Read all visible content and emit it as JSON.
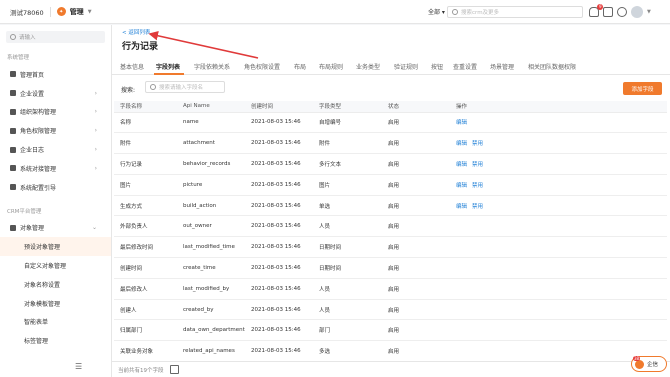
{
  "topbar": {
    "company": "测试78060",
    "module": "管理",
    "scope": "全部 ▾",
    "search_placeholder": "搜索crm及更多",
    "notification_count": "9"
  },
  "sidebar": {
    "search_placeholder": "请输入",
    "group_system": "系统管理",
    "items": [
      {
        "label": "管理首页"
      },
      {
        "label": "企业设置"
      },
      {
        "label": "组织架构管理"
      },
      {
        "label": "角色权限管理"
      },
      {
        "label": "企业日志"
      },
      {
        "label": "系统对接管理"
      },
      {
        "label": "系统配置引导"
      }
    ],
    "group_crm": "CRM平台管理",
    "object_mgmt": "对象管理",
    "sub_items": [
      {
        "label": "预设对象管理"
      },
      {
        "label": "自定义对象管理"
      },
      {
        "label": "对象名称设置"
      },
      {
        "label": "对象模板管理"
      },
      {
        "label": "智能表单"
      },
      {
        "label": "标签管理"
      }
    ]
  },
  "main": {
    "back": "< 返回列表",
    "title": "行为记录",
    "tabs": [
      {
        "label": "基本信息"
      },
      {
        "label": "字段列表"
      },
      {
        "label": "字段依赖关系"
      },
      {
        "label": "角色权限设置"
      },
      {
        "label": "布局"
      },
      {
        "label": "布局规则"
      },
      {
        "label": "业务类型"
      },
      {
        "label": "验证规则"
      },
      {
        "label": "按钮"
      },
      {
        "label": "查重设置"
      },
      {
        "label": "场景管理"
      },
      {
        "label": "相关团队数据权限"
      }
    ],
    "filter_label": "搜索:",
    "filter_placeholder": "搜索请输入字段名",
    "add_button": "添加字段",
    "columns": [
      "字段名称",
      "Api Name",
      "创建时间",
      "字段类型",
      "状态",
      "操作"
    ],
    "rows": [
      [
        "名称",
        "name",
        "2021-08-03 15:46",
        "自增编号",
        "启用",
        "编辑",
        ""
      ],
      [
        "附件",
        "attachment",
        "2021-08-03 15:46",
        "附件",
        "启用",
        "编辑",
        "禁用"
      ],
      [
        "行为记录",
        "behavior_records",
        "2021-08-03 15:46",
        "多行文本",
        "启用",
        "编辑",
        "禁用"
      ],
      [
        "图片",
        "picture",
        "2021-08-03 15:46",
        "图片",
        "启用",
        "编辑",
        "禁用"
      ],
      [
        "生成方式",
        "build_action",
        "2021-08-03 15:46",
        "单选",
        "启用",
        "编辑",
        "禁用"
      ],
      [
        "外部负责人",
        "out_owner",
        "2021-08-03 15:46",
        "人员",
        "启用",
        "",
        ""
      ],
      [
        "最后修改时间",
        "last_modified_time",
        "2021-08-03 15:46",
        "日期时间",
        "启用",
        "",
        ""
      ],
      [
        "创建时间",
        "create_time",
        "2021-08-03 15:46",
        "日期时间",
        "启用",
        "",
        ""
      ],
      [
        "最后修改人",
        "last_modified_by",
        "2021-08-03 15:46",
        "人员",
        "启用",
        "",
        ""
      ],
      [
        "创建人",
        "created_by",
        "2021-08-03 15:46",
        "人员",
        "启用",
        "",
        ""
      ],
      [
        "归属部门",
        "data_own_department",
        "2021-08-03 15:46",
        "部门",
        "启用",
        "",
        ""
      ],
      [
        "关联业务对象",
        "related_api_names",
        "2021-08-03 15:46",
        "多选",
        "启用",
        "",
        ""
      ]
    ],
    "footer": "当前共有19个字段"
  },
  "qiyu": {
    "label": "企信",
    "badge": "38"
  },
  "colors": {
    "accent": "#f07a2d",
    "link": "#1e7fd6",
    "annotation_arrow": "#e03a3a"
  }
}
